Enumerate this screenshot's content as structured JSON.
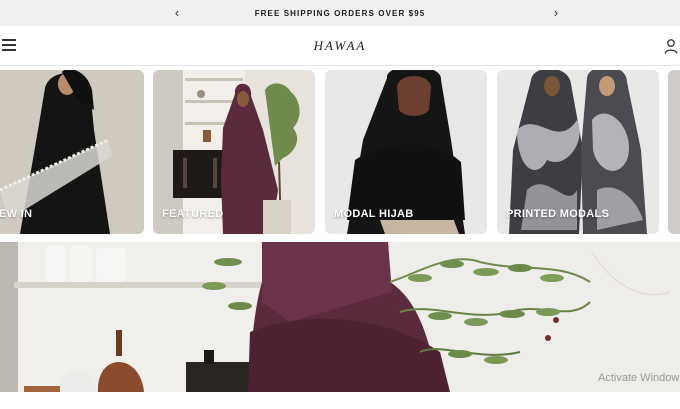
{
  "announcement": {
    "text": "FREE SHIPPING ORDERS OVER $95",
    "prev_icon": "chevron-left",
    "next_icon": "chevron-right"
  },
  "header": {
    "menu_icon": "hamburger",
    "logo": "HAWAA",
    "account_icon": "user"
  },
  "categories": [
    {
      "label": "EW IN"
    },
    {
      "label": "FEATURED"
    },
    {
      "label": "MODAL HIJAB"
    },
    {
      "label": "PRINTED MODALS"
    }
  ],
  "watermark": "Activate Window",
  "colors": {
    "announcement_bg": "#f0f0ef",
    "text_dark": "#1b1b1b",
    "card_caption": "#ffffff",
    "plum": "#5b2a3c",
    "black_hijab": "#151515"
  }
}
